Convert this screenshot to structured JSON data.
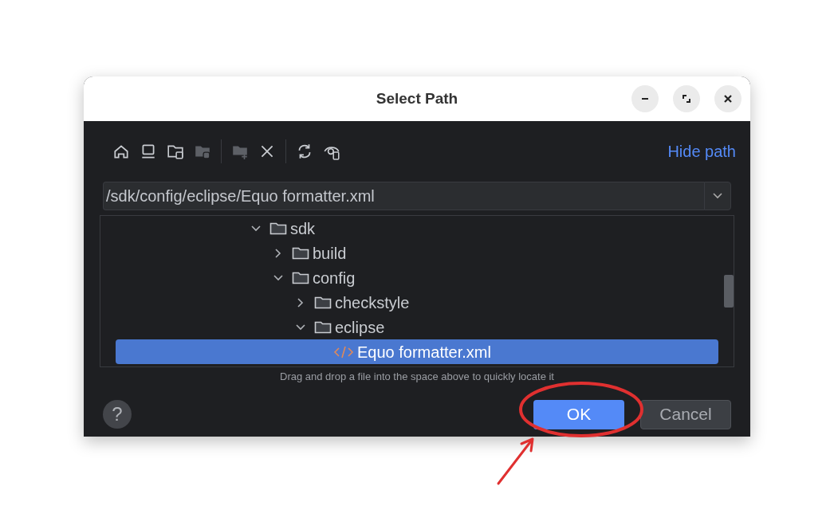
{
  "window": {
    "title": "Select Path"
  },
  "title_buttons": [
    {
      "kind": "minimize"
    },
    {
      "kind": "maximize"
    },
    {
      "kind": "close"
    }
  ],
  "toolbar": [
    {
      "kind": "home",
      "disabled": false
    },
    {
      "kind": "desktop",
      "disabled": false
    },
    {
      "kind": "project",
      "disabled": false
    },
    {
      "kind": "module",
      "disabled": true
    },
    {
      "kind": "separator"
    },
    {
      "kind": "new-folder",
      "disabled": true
    },
    {
      "kind": "delete",
      "disabled": false
    },
    {
      "kind": "separator"
    },
    {
      "kind": "refresh",
      "disabled": false
    },
    {
      "kind": "hidden",
      "disabled": false
    }
  ],
  "hide_path_link": "Hide path",
  "path_field": {
    "value": "/sdk/config/eclipse/Equo formatter.xml"
  },
  "tree": [
    {
      "name": "sdk",
      "kind": "folder",
      "expanded": true,
      "selected": false,
      "children": [
        {
          "name": "build",
          "kind": "folder",
          "expanded": false,
          "selected": false
        },
        {
          "name": "config",
          "kind": "folder",
          "expanded": true,
          "selected": false,
          "children": [
            {
              "name": "checkstyle",
              "kind": "folder",
              "expanded": false,
              "selected": false
            },
            {
              "name": "eclipse",
              "kind": "folder",
              "expanded": true,
              "selected": false,
              "children": [
                {
                  "name": "Equo formatter.xml",
                  "kind": "xml",
                  "selected": true
                }
              ]
            }
          ]
        }
      ]
    }
  ],
  "hint": "Drag and drop a file into the space above to quickly locate it",
  "help_button": "?",
  "buttons": [
    {
      "label": "OK",
      "kind": "primary"
    },
    {
      "label": "Cancel",
      "kind": "secondary"
    }
  ]
}
